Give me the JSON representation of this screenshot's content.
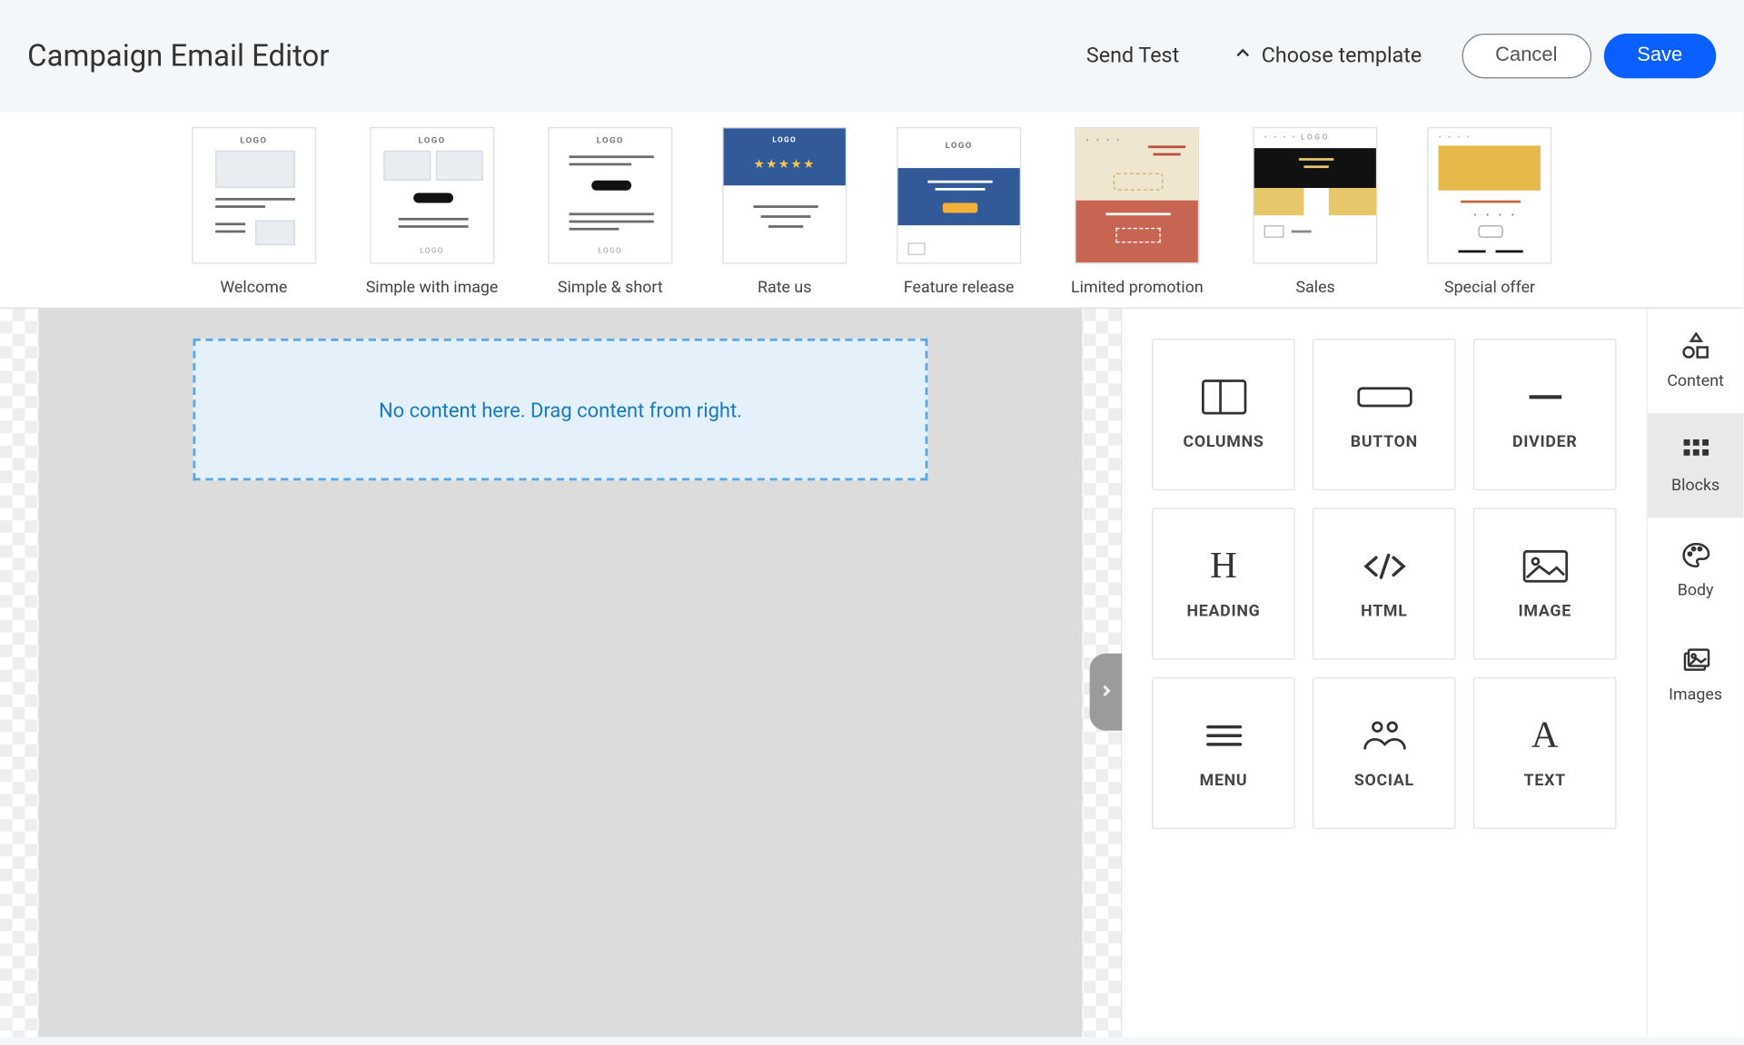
{
  "header": {
    "title": "Campaign Email Editor",
    "send_test": "Send Test",
    "choose_template": "Choose template",
    "cancel": "Cancel",
    "save": "Save"
  },
  "templates": [
    {
      "id": "welcome",
      "label": "Welcome"
    },
    {
      "id": "simpleimg",
      "label": "Simple with image"
    },
    {
      "id": "simpleshort",
      "label": "Simple & short"
    },
    {
      "id": "rateus",
      "label": "Rate us"
    },
    {
      "id": "feature",
      "label": "Feature release"
    },
    {
      "id": "limited",
      "label": "Limited promotion"
    },
    {
      "id": "sales",
      "label": "Sales"
    },
    {
      "id": "special",
      "label": "Special offer"
    }
  ],
  "canvas": {
    "empty_message": "No content here. Drag content from right."
  },
  "blocks": [
    {
      "id": "columns",
      "label": "COLUMNS"
    },
    {
      "id": "button",
      "label": "BUTTON"
    },
    {
      "id": "divider",
      "label": "DIVIDER"
    },
    {
      "id": "heading",
      "label": "HEADING"
    },
    {
      "id": "html",
      "label": "HTML"
    },
    {
      "id": "image",
      "label": "IMAGE"
    },
    {
      "id": "menu",
      "label": "MENU"
    },
    {
      "id": "social",
      "label": "SOCIAL"
    },
    {
      "id": "text",
      "label": "TEXT"
    }
  ],
  "tabs": [
    {
      "id": "content",
      "label": "Content"
    },
    {
      "id": "blocks",
      "label": "Blocks"
    },
    {
      "id": "body",
      "label": "Body"
    },
    {
      "id": "images",
      "label": "Images"
    }
  ],
  "active_tab": "blocks",
  "thumbnail_text": {
    "logo": "LOGO",
    "stars": "★★★★★",
    "dots": "• • • •"
  }
}
